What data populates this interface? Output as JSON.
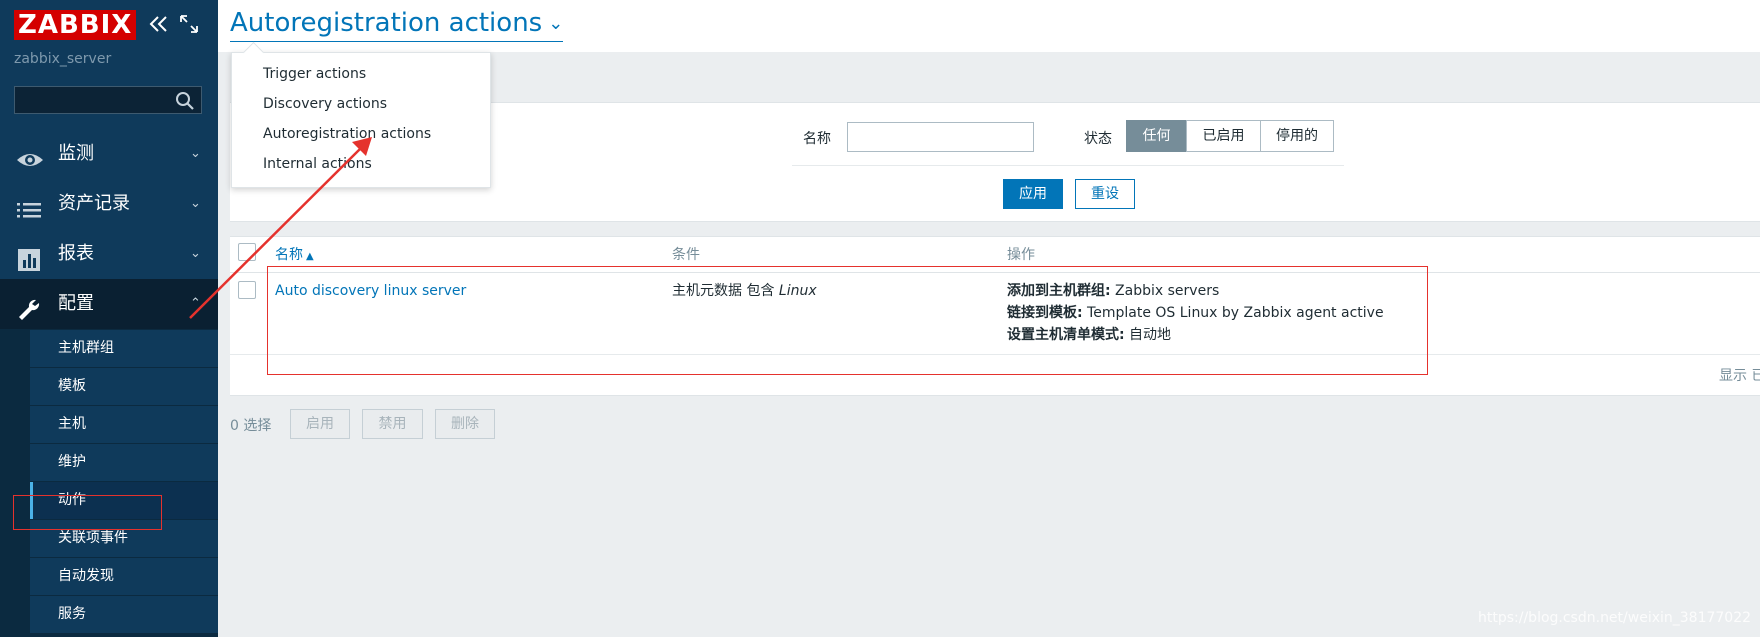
{
  "sidebar": {
    "logo": "ZABBIX",
    "server_name": "zabbix_server",
    "search_placeholder": "",
    "menu": [
      {
        "label": "监测",
        "icon": "eye-icon"
      },
      {
        "label": "资产记录",
        "icon": "list-icon"
      },
      {
        "label": "报表",
        "icon": "bar-chart-icon"
      },
      {
        "label": "配置",
        "icon": "wrench-icon"
      }
    ],
    "submenu": [
      "主机群组",
      "模板",
      "主机",
      "维护",
      "动作",
      "关联项事件",
      "自动发现",
      "服务"
    ],
    "selected_submenu": "动作"
  },
  "header": {
    "title": "Autoregistration actions"
  },
  "dropdown": {
    "items": [
      "Trigger actions",
      "Discovery actions",
      "Autoregistration actions",
      "Internal actions"
    ]
  },
  "filter": {
    "name_label": "名称",
    "name_value": "",
    "status_label": "状态",
    "status_options": [
      "任何",
      "已启用",
      "停用的"
    ],
    "status_selected": "任何",
    "apply_label": "应用",
    "reset_label": "重设"
  },
  "table": {
    "columns": [
      "名称",
      "条件",
      "操作"
    ],
    "sort_indicator": "▲",
    "rows": [
      {
        "name": "Auto discovery linux server",
        "condition_prefix": "主机元数据 包含 ",
        "condition_value": "Linux",
        "operations": [
          {
            "label": "添加到主机群组:",
            "value": " Zabbix servers"
          },
          {
            "label": "链接到模板:",
            "value": " Template OS Linux by Zabbix agent active"
          },
          {
            "label": "设置主机清单模式:",
            "value": " 自动地"
          }
        ]
      }
    ],
    "paging_text": "显示 已"
  },
  "bulk": {
    "selected_count": "0 选择",
    "buttons": [
      "启用",
      "禁用",
      "删除"
    ]
  },
  "watermark": "https://blog.csdn.net/weixin_38177022",
  "colors": {
    "accent": "#0275b8",
    "sidebar": "#0f3a5b",
    "logo_bg": "#d40000",
    "annotation": "#e5322d"
  }
}
